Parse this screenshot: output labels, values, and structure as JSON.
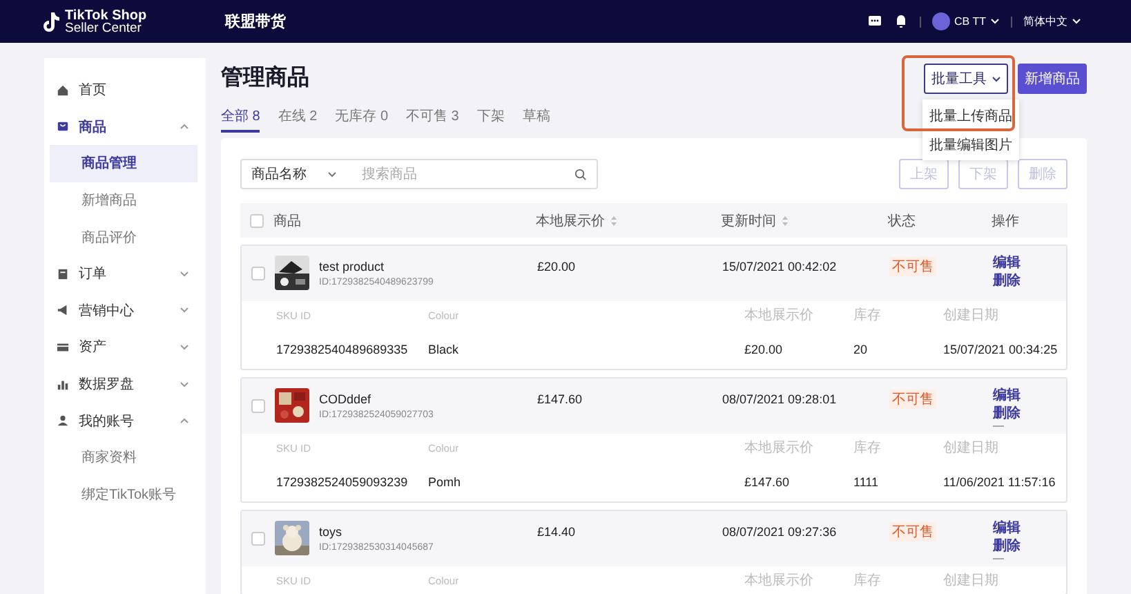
{
  "topbar": {
    "logo_line1": "TikTok Shop",
    "logo_line2": "Seller Center",
    "nav": "联盟带货",
    "user": "CB TT",
    "language": "简体中文"
  },
  "sidebar": {
    "items": [
      {
        "label": "首页",
        "selected": false
      },
      {
        "label": "商品",
        "selected": true,
        "expanded": true,
        "children": [
          {
            "label": "商品管理",
            "selected": true
          },
          {
            "label": "新增商品",
            "selected": false
          },
          {
            "label": "商品评价",
            "selected": false
          }
        ]
      },
      {
        "label": "订单",
        "selected": false,
        "expanded": false
      },
      {
        "label": "营销中心",
        "selected": false,
        "expanded": false
      },
      {
        "label": "资产",
        "selected": false,
        "expanded": false
      },
      {
        "label": "数据罗盘",
        "selected": false,
        "expanded": false
      },
      {
        "label": "我的账号",
        "selected": false,
        "expanded": true,
        "children": [
          {
            "label": "商家资料",
            "selected": false
          },
          {
            "label": "绑定TikTok账号",
            "selected": false
          }
        ]
      }
    ]
  },
  "page": {
    "title": "管理商品",
    "tabs": [
      {
        "label": "全部 8",
        "selected": true
      },
      {
        "label": "在线 2",
        "selected": false
      },
      {
        "label": "无库存 0",
        "selected": false
      },
      {
        "label": "不可售 3",
        "selected": false
      },
      {
        "label": "下架",
        "selected": false
      },
      {
        "label": "草稿",
        "selected": false
      }
    ],
    "batch_tools": {
      "label": "批量工具",
      "expanded": true,
      "highlighted": true,
      "menu": [
        "批量上传商品",
        "批量编辑图片"
      ]
    },
    "new_button": "新增商品"
  },
  "search": {
    "field": "商品名称",
    "placeholder": "搜索商品"
  },
  "bulk_actions": [
    {
      "label": "上架",
      "disabled": true
    },
    {
      "label": "下架",
      "disabled": true
    },
    {
      "label": "删除",
      "disabled": true
    }
  ],
  "table": {
    "select_all_checked": false,
    "columns": [
      {
        "label": "商品",
        "sortable": false
      },
      {
        "label": "本地展示价",
        "sortable": true
      },
      {
        "label": "更新时间",
        "sortable": true
      },
      {
        "label": "状态",
        "sortable": false
      },
      {
        "label": "操作",
        "sortable": false
      }
    ],
    "products": [
      {
        "name": "test product",
        "id": "ID:1729382540489623799",
        "price": "£20.00",
        "updated": "15/07/2021 00:42:02",
        "status": "不可售",
        "actions": [
          "编辑",
          "删除"
        ],
        "more": false,
        "checked": false,
        "sku_columns": [
          "SKU ID",
          "Colour",
          "本地展示价",
          "库存",
          "创建日期"
        ],
        "skus": [
          [
            "1729382540489689335",
            "Black",
            "£20.00",
            "20",
            "15/07/2021 00:34:25"
          ]
        ]
      },
      {
        "name": "CODddef",
        "id": "ID:1729382524059027703",
        "price": "£147.60",
        "updated": "08/07/2021 09:28:01",
        "status": "不可售",
        "actions": [
          "编辑",
          "删除"
        ],
        "more": true,
        "checked": false,
        "sku_columns": [
          "SKU ID",
          "Colour",
          "本地展示价",
          "库存",
          "创建日期"
        ],
        "skus": [
          [
            "1729382524059093239",
            "Pomh",
            "£147.60",
            "1111",
            "11/06/2021 11:57:16"
          ]
        ]
      },
      {
        "name": "toys",
        "id": "ID:1729382530314045687",
        "price": "£14.40",
        "updated": "08/07/2021 09:27:36",
        "status": "不可售",
        "actions": [
          "编辑",
          "删除"
        ],
        "more": true,
        "checked": false,
        "sku_columns": [
          "SKU ID",
          "Colour",
          "本地展示价",
          "库存",
          "创建日期"
        ]
      }
    ]
  }
}
